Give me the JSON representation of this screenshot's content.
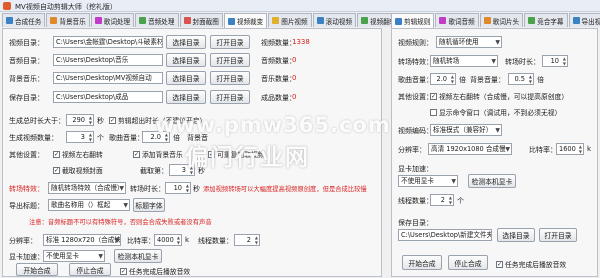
{
  "window": {
    "title": "MV视频自动剪辑大师（挖礼版）"
  },
  "colors": {
    "accent_red": "#d81e1e",
    "tab_active": "#fbfbfb"
  },
  "left_tabs": [
    {
      "label": "合成任务",
      "icon": "task-icon",
      "color": "#3b82c4"
    },
    {
      "label": "背景音乐",
      "icon": "music-icon",
      "color": "#e08a2a"
    },
    {
      "label": "歌词处理",
      "icon": "lyrics-icon",
      "color": "#c23ac9"
    },
    {
      "label": "音频处理",
      "icon": "audio-icon",
      "color": "#4aa34a"
    },
    {
      "label": "封面截图",
      "icon": "image-icon",
      "color": "#d9534f"
    },
    {
      "label": "视频裁变",
      "icon": "video-icon",
      "color": "#3b82c4"
    },
    {
      "label": "图片视频",
      "icon": "picture-icon",
      "color": "#e0b02a"
    },
    {
      "label": "滚动视频",
      "icon": "scroll-icon",
      "color": "#3b82c4"
    },
    {
      "label": "视频翻转",
      "icon": "flip-icon",
      "color": "#4aa34a"
    }
  ],
  "right_tabs": [
    {
      "label": "剪辑规则",
      "icon": "rules-icon",
      "color": "#3b82c4"
    },
    {
      "label": "歌词音频",
      "icon": "lyrics-audio-icon",
      "color": "#c23ac9"
    },
    {
      "label": "歌词片头",
      "icon": "intro-icon",
      "color": "#e08a2a"
    },
    {
      "label": "竞合字幕",
      "icon": "subtitle-icon",
      "color": "#4aa34a"
    },
    {
      "label": "导出视",
      "icon": "export-icon",
      "color": "#3b82c4"
    }
  ],
  "left": {
    "video_dir": {
      "label": "视频目录：",
      "value": "C:\\Users\\金帐霆\\Desktop\\斗破素材\\",
      "select": "选择目录",
      "open": "打开目录",
      "count_label": "视频数量：",
      "count": "1338"
    },
    "audio_dir": {
      "label": "音频目录：",
      "value": "C:\\Users\\Desktop\\音乐",
      "select": "选择目录",
      "open": "打开目录",
      "count_label": "音频数量：",
      "count": "0"
    },
    "bgm_dir": {
      "label": "背景音乐：",
      "value": "C:\\Users\\Desktop\\MV视频自动",
      "select": "选择目录",
      "open": "打开目录",
      "count_label": "音乐数量：",
      "count": "0"
    },
    "save_dir": {
      "label": "保存目录：",
      "value": "C:\\Users\\Desktop\\成品",
      "select": "选择目录",
      "open": "打开目录",
      "count_label": "成品数量：",
      "count": "0"
    },
    "gen_duration": {
      "label": "生成总时长大于：",
      "value": "290",
      "unit": "秒",
      "cut_label": "剪辑超出时长（不建议开启）"
    },
    "gen_count": {
      "label": "生成视频数量：",
      "value": "3",
      "unit": "个",
      "vol_label": "歌曲音量：",
      "vol_value": "2.0",
      "unit2": "倍",
      "bg_label": "背景音"
    },
    "other": {
      "label": "其他设置：",
      "opt1": "视频左右翻转",
      "opt2": "添加背景音乐",
      "opt3": "可重复加取视频",
      "opt4": "截取视频封面",
      "cut_pos_label": "截取第：",
      "cut_pos": "3",
      "cut_pos_unit": "秒"
    },
    "transition": {
      "label": "转场特效：",
      "value": "随机转场特效（合成慢）",
      "dur_label": "转场时长：",
      "dur": "10",
      "unit": "秒",
      "note": "添加视频转场可以大幅度提高视频原创度，但是合成比较慢"
    },
    "title": {
      "label": "导出标题：",
      "value": "歌曲名称用（）框起",
      "font_label": "标题字体",
      "note": "注意：音频标题不可以有特殊符号，否则会合成失败或者没有声音"
    },
    "resolution": {
      "label": "分辨率：",
      "value": "标准 1280x720（合成快",
      "bitrate_label": "比特率：",
      "bitrate": "4000",
      "bitrate_unit": "k",
      "threads_label": "线程数量：",
      "threads": "2"
    },
    "gpu": {
      "label": "显卡加速：",
      "value": "不使用显卡",
      "detect": "检测本机显卡"
    },
    "actions": {
      "start": "开始合成",
      "stop": "停止合成",
      "done_sound": "任务完成后播放音效"
    }
  },
  "right": {
    "video_rule": {
      "label": "视频规则：",
      "value": "随机循环使用"
    },
    "transition": {
      "label": "转场特效：",
      "value": "随机转场",
      "dur_label": "转场时长：",
      "dur": "10"
    },
    "song_vol": {
      "label": "歌曲音量：",
      "value": "2.0",
      "bg_label": "背景音量：",
      "bg_value": "0.5",
      "unit": "倍"
    },
    "other": {
      "label": "其他设置：",
      "opt1": "视频左右翻转",
      "opt1_note": "（合成慢，可以提高原创度）",
      "opt2": "显示命令窗口",
      "opt2_note": "（调试用，不到必须无视）"
    },
    "encode": {
      "label": "视频编码：",
      "value": "标准模式（兼容好）"
    },
    "resolution": {
      "label": "分辨率：",
      "value": "高清 1920x1080 合成慢",
      "bitrate_label": "比特率：",
      "bitrate": "1600",
      "bitrate_unit": "k"
    },
    "gpu": {
      "label": "显卡加速：",
      "value": "不使用显卡",
      "detect": "检测本机显卡"
    },
    "threads": {
      "label": "线程数量：",
      "value": "2",
      "unit": "个"
    },
    "save_dir": {
      "label": "保存目录：",
      "value": "C:\\Users\\Desktop\\新建文件夹（2",
      "select": "选择目录",
      "open": "打开目录"
    },
    "actions": {
      "start": "开始合成",
      "stop": "停止合成",
      "done_sound": "任务完成后播放音效"
    }
  },
  "watermark": {
    "line1": "www.pmw365.com",
    "line2": "偏门行业网"
  }
}
